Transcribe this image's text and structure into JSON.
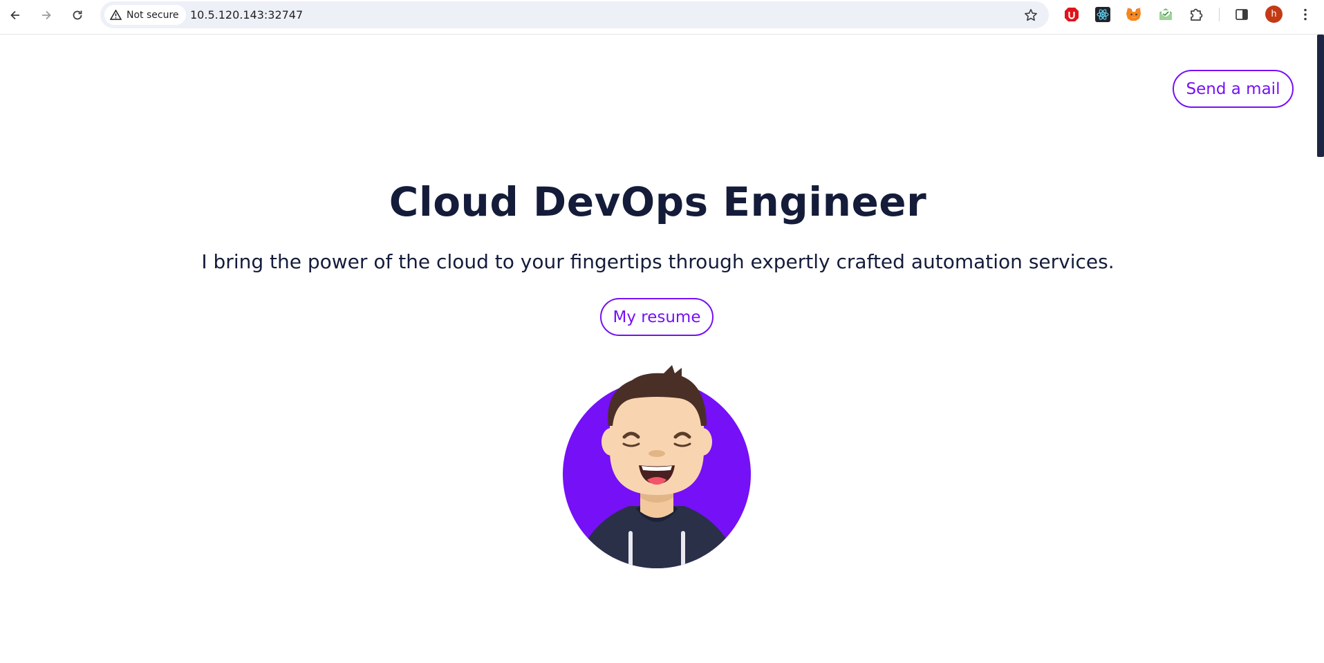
{
  "browser": {
    "security_label": "Not secure",
    "url": "10.5.120.143:32747",
    "profile_initial": "h",
    "extensions": [
      "ublock-icon",
      "react-devtools-icon",
      "metamask-icon",
      "mail-extension-icon",
      "extensions-puzzle-icon"
    ]
  },
  "page": {
    "send_mail_label": "Send a mail",
    "title": "Cloud DevOps Engineer",
    "subtitle": "I bring the power of the cloud to your fingertips through expertly crafted automation services.",
    "resume_label": "My resume"
  },
  "colors": {
    "accent": "#7510f7",
    "heading": "#141c3a",
    "hoodie": "#2a3048",
    "skin": "#f8d5b0",
    "hair": "#4a2f27"
  }
}
